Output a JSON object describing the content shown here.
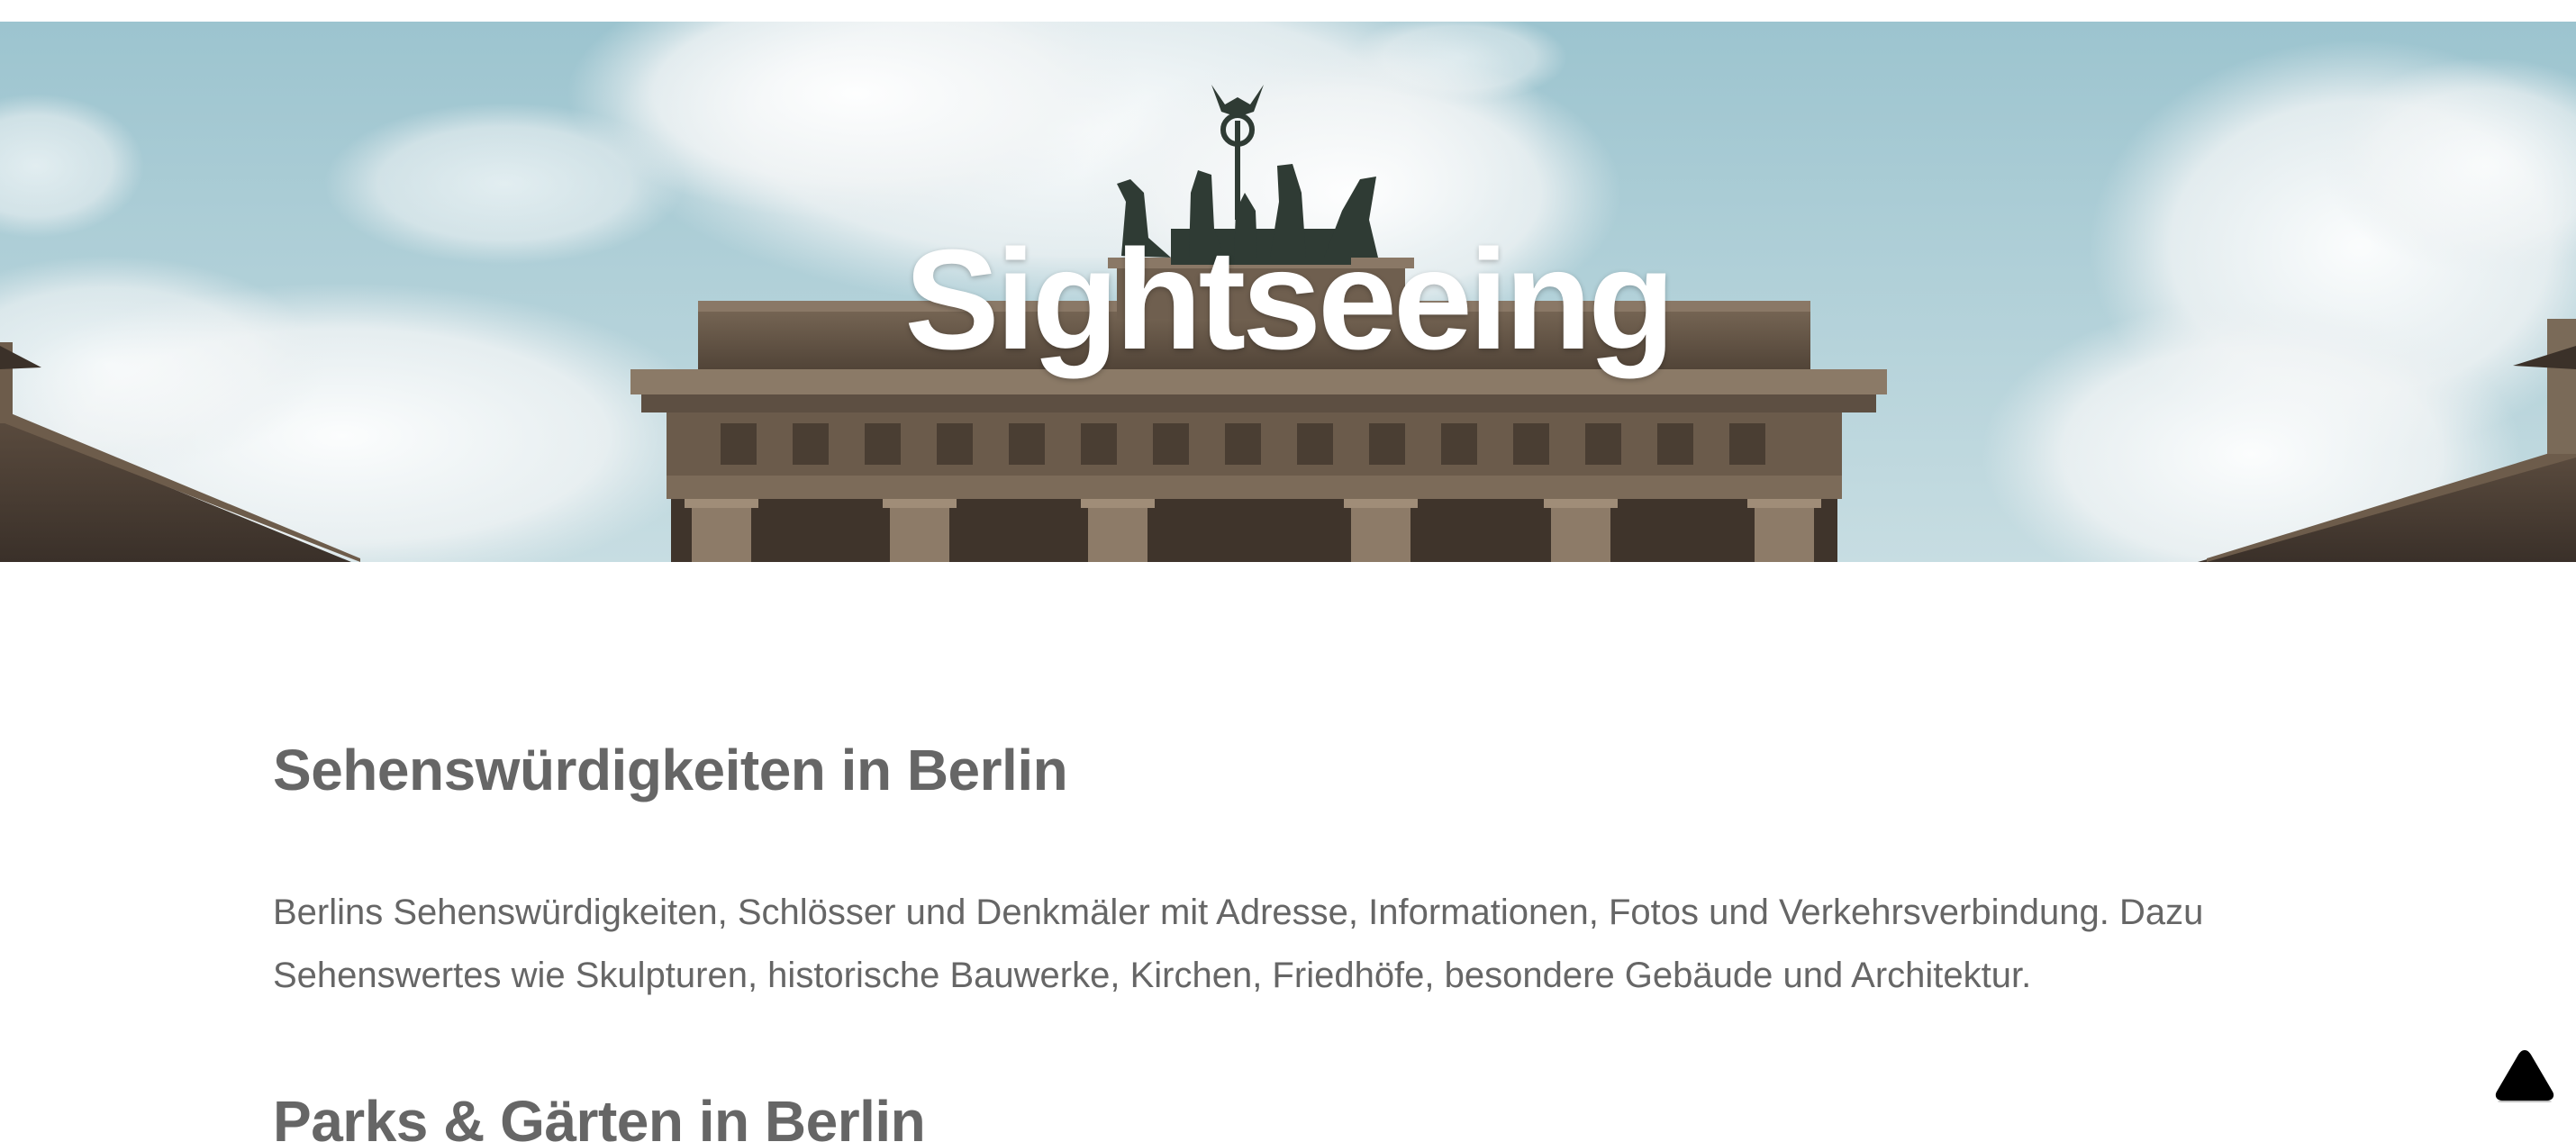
{
  "hero": {
    "title": "Sightseeing"
  },
  "sections": [
    {
      "heading": "Sehenswürdigkeiten in Berlin",
      "text": "Berlins Sehenswürdigkeiten, Schlösser und Denkmäler mit Adresse, Informationen, Fotos und Verkehrsverbindung. Dazu Sehenswertes wie Skulpturen, historische Bauwerke, Kirchen, Friedhöfe, besondere Gebäude und Architektur."
    },
    {
      "heading": "Parks & Gärten in Berlin"
    }
  ],
  "scroll_top": {
    "icon": "triangle-up-icon"
  }
}
